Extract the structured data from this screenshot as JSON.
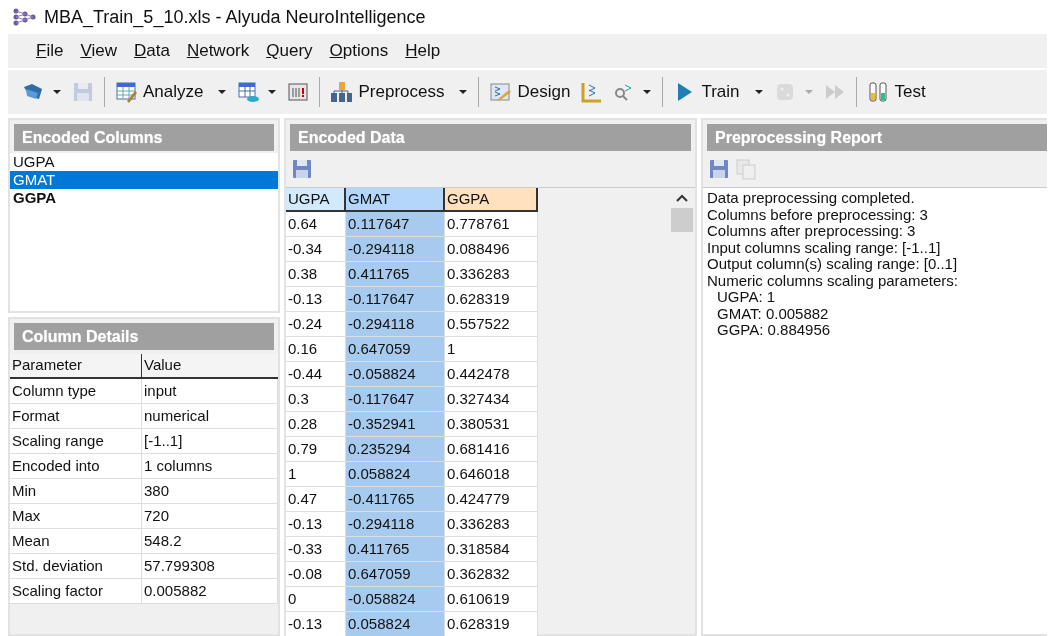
{
  "window": {
    "title": "MBA_Train_5_10.xls - Alyuda NeuroIntelligence"
  },
  "menu": [
    "File",
    "View",
    "Data",
    "Network",
    "Query",
    "Options",
    "Help"
  ],
  "toolbar": [
    {
      "kind": "icon",
      "dropdown": true,
      "disabled": false
    },
    {
      "kind": "icon",
      "dropdown": false,
      "disabled": true
    },
    {
      "kind": "separator"
    },
    {
      "kind": "text",
      "label": "Analyze",
      "dropdown": true,
      "disabled": false
    },
    {
      "kind": "icon",
      "dropdown": true,
      "disabled": false
    },
    {
      "kind": "icon",
      "dropdown": false,
      "disabled": false
    },
    {
      "kind": "separator"
    },
    {
      "kind": "text",
      "label": "Preprocess",
      "dropdown": true,
      "disabled": false
    },
    {
      "kind": "separator"
    },
    {
      "kind": "text",
      "label": "Design",
      "dropdown": false,
      "disabled": false
    },
    {
      "kind": "icon",
      "dropdown": false,
      "disabled": false
    },
    {
      "kind": "icon",
      "dropdown": true,
      "disabled": false
    },
    {
      "kind": "separator"
    },
    {
      "kind": "text",
      "label": "Train",
      "dropdown": true,
      "disabled": false
    },
    {
      "kind": "icon",
      "dropdown": true,
      "disabled": true
    },
    {
      "kind": "icon",
      "dropdown": false,
      "disabled": true
    },
    {
      "kind": "separator"
    },
    {
      "kind": "text",
      "label": "Test",
      "dropdown": false,
      "disabled": false
    }
  ],
  "encoded_columns": {
    "title": "Encoded Columns",
    "items": [
      {
        "label": "UGPA",
        "output": false,
        "selected": false
      },
      {
        "label": "GMAT",
        "output": false,
        "selected": true
      },
      {
        "label": "GGPA",
        "output": true,
        "selected": false
      }
    ]
  },
  "column_details": {
    "title": "Column Details",
    "columns": [
      "Parameter",
      "Value"
    ],
    "rows": [
      [
        "Column type",
        "input"
      ],
      [
        "Format",
        "numerical"
      ],
      [
        "Scaling range",
        "[-1..1]"
      ],
      [
        "Encoded into",
        "1 columns"
      ],
      [
        "Min",
        "380"
      ],
      [
        "Max",
        "720"
      ],
      [
        "Mean",
        "548.2"
      ],
      [
        "Std. deviation",
        "57.799308"
      ],
      [
        "Scaling factor",
        "0.005882"
      ]
    ]
  },
  "encoded_data": {
    "title": "Encoded Data",
    "columns": [
      {
        "label": "UGPA",
        "output": false,
        "selected": false
      },
      {
        "label": "GMAT",
        "output": false,
        "selected": true
      },
      {
        "label": "GGPA",
        "output": true,
        "selected": false
      }
    ],
    "rows": [
      [
        "0.64",
        "0.117647",
        "0.778761"
      ],
      [
        "-0.34",
        "-0.294118",
        "0.088496"
      ],
      [
        "0.38",
        "0.411765",
        "0.336283"
      ],
      [
        "-0.13",
        "-0.117647",
        "0.628319"
      ],
      [
        "-0.24",
        "-0.294118",
        "0.557522"
      ],
      [
        "0.16",
        "0.647059",
        "1"
      ],
      [
        "-0.44",
        "-0.058824",
        "0.442478"
      ],
      [
        "0.3",
        "-0.117647",
        "0.327434"
      ],
      [
        "0.28",
        "-0.352941",
        "0.380531"
      ],
      [
        "0.79",
        "0.235294",
        "0.681416"
      ],
      [
        "1",
        "0.058824",
        "0.646018"
      ],
      [
        "0.47",
        "-0.411765",
        "0.424779"
      ],
      [
        "-0.13",
        "-0.294118",
        "0.336283"
      ],
      [
        "-0.33",
        "0.411765",
        "0.318584"
      ],
      [
        "-0.08",
        "0.647059",
        "0.362832"
      ],
      [
        "0",
        "-0.058824",
        "0.610619"
      ],
      [
        "-0.13",
        "0.058824",
        "0.628319"
      ]
    ]
  },
  "report": {
    "title": "Preprocessing Report",
    "lines": [
      {
        "text": "Data preprocessing completed.",
        "indent": false
      },
      {
        "text": "Columns before preprocessing: 3",
        "indent": false
      },
      {
        "text": "Columns after preprocessing: 3",
        "indent": false
      },
      {
        "text": "Input columns scaling range: [-1..1]",
        "indent": false
      },
      {
        "text": "Output column(s) scaling range: [0..1]",
        "indent": false
      },
      {
        "text": "Numeric columns scaling parameters:",
        "indent": false
      },
      {
        "text": "UGPA: 1",
        "indent": true
      },
      {
        "text": "GMAT: 0.005882",
        "indent": true
      },
      {
        "text": "GGPA: 0.884956",
        "indent": true
      }
    ]
  }
}
